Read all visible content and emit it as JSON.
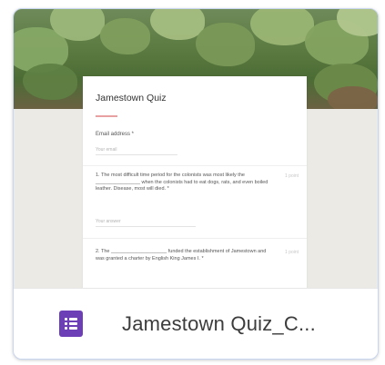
{
  "document": {
    "name": "Jamestown Quiz_C...",
    "icon": "google-forms-icon"
  },
  "preview": {
    "form_title": "Jamestown Quiz",
    "email_label": "Email address *",
    "email_placeholder": "Your email",
    "question1": "1. The most difficult time period for the colonists was most likely the ________________ when the colonists had to eat dogs, rats, and even boiled leather. Disease, most will died. *",
    "question1_points": "1 point",
    "question1_placeholder": "Your answer",
    "question2": "2. The ____________________ funded the establishment of Jamestown and was granted a charter by English King James I. *",
    "question2_points": "1 point"
  },
  "colors": {
    "forms_purple": "#6c3fb6",
    "card_border": "#c9d6f0"
  }
}
